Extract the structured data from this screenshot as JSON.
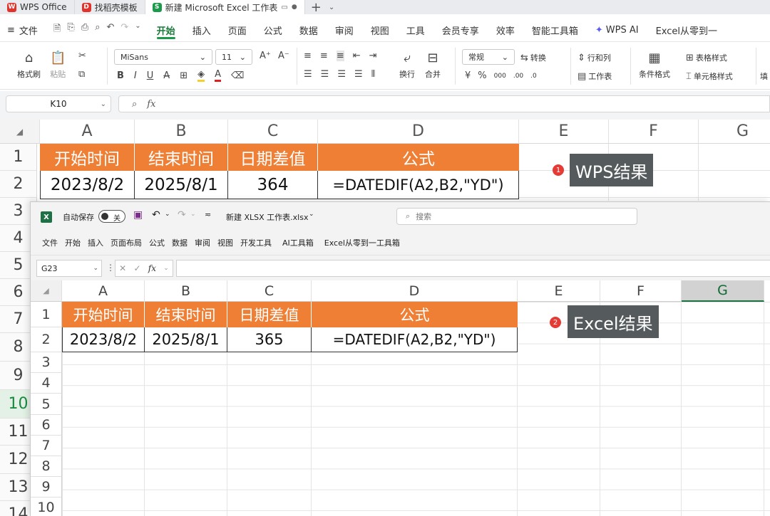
{
  "tabs": [
    {
      "label": "WPS Office",
      "icon": "wps-logo-icon",
      "color": "#e0332c"
    },
    {
      "label": "找稻壳模板",
      "icon": "docer-icon",
      "color": "#e0332c"
    },
    {
      "label": "新建 Microsoft Excel 工作表",
      "icon": "sheet-icon",
      "color": "#1a9a4a",
      "active": true
    }
  ],
  "wps_menu": {
    "file": "文件",
    "items": [
      "开始",
      "插入",
      "页面",
      "公式",
      "数据",
      "审阅",
      "视图",
      "工具",
      "会员专享",
      "效率",
      "智能工具箱"
    ],
    "active": "开始",
    "ai": "WPS AI",
    "plugin": "Excel从零到一"
  },
  "ribbon": {
    "format_painter": "格式刷",
    "paste": "粘贴",
    "font_name": "MiSans",
    "font_size": "11",
    "number_format": "常规",
    "convert": "转换",
    "row_col": "行和列",
    "worksheet": "工作表",
    "wrap": "换行",
    "merge": "合并",
    "cond_format": "条件格式",
    "table_style": "表格样式",
    "cell_style": "单元格样式",
    "fill": "填"
  },
  "wps_formula": {
    "name_box": "K10",
    "fx": "fx"
  },
  "wps_sheet": {
    "columns": [
      "A",
      "B",
      "C",
      "D",
      "E",
      "F",
      "G"
    ],
    "rows": [
      "1",
      "2",
      "3",
      "4",
      "5",
      "6",
      "7",
      "8",
      "9",
      "10",
      "11",
      "12",
      "13",
      "14"
    ],
    "selected_row": "10",
    "header": [
      "开始时间",
      "结束时间",
      "日期差值",
      "公式"
    ],
    "values": [
      "2023/8/2",
      "2025/8/1",
      "364",
      "=DATEDIF(A2,B2,\"YD\")"
    ],
    "header_color": "#ee7f35",
    "callout_num": "1",
    "callout_text": "WPS结果"
  },
  "excel": {
    "autosave": "自动保存",
    "toggle": "关",
    "filename": "新建 XLSX 工作表.xlsx",
    "search": "搜索",
    "menu": [
      "文件",
      "开始",
      "插入",
      "页面布局",
      "公式",
      "数据",
      "审阅",
      "视图",
      "开发工具",
      "AI工具箱",
      "Excel从零到一工具箱"
    ],
    "name_box": "G23",
    "fx": "fx",
    "columns": [
      "A",
      "B",
      "C",
      "D",
      "E",
      "F",
      "G"
    ],
    "rows": [
      "1",
      "2",
      "3",
      "4",
      "5",
      "6",
      "7",
      "8",
      "9",
      "10"
    ],
    "selected_col": "G",
    "header": [
      "开始时间",
      "结束时间",
      "日期差值",
      "公式"
    ],
    "values": [
      "2023/8/2",
      "2025/8/1",
      "365",
      "=DATEDIF(A2,B2,\"YD\")"
    ],
    "callout_num": "2",
    "callout_text": "Excel结果"
  }
}
